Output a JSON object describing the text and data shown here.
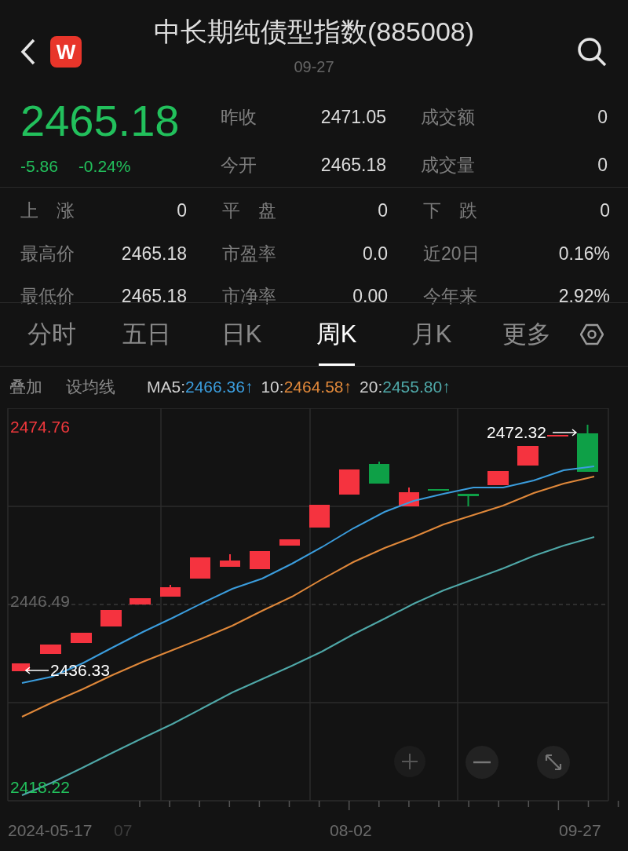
{
  "header": {
    "title": "中长期纯债型指数(885008)",
    "date": "09-27",
    "badge": "W"
  },
  "quote": {
    "price": "2465.18",
    "change": "-5.86",
    "change_pct": "-0.24%",
    "color": "#22c05c"
  },
  "quote_stats": [
    {
      "label": "昨收",
      "value": "2471.05"
    },
    {
      "label": "成交额",
      "value": "0"
    },
    {
      "label": "今开",
      "value": "2465.18"
    },
    {
      "label": "成交量",
      "value": "0"
    }
  ],
  "stats": [
    {
      "label": "上　涨",
      "value": "0"
    },
    {
      "label": "平　盘",
      "value": "0"
    },
    {
      "label": "下　跌",
      "value": "0"
    },
    {
      "label": "最高价",
      "value": "2465.18"
    },
    {
      "label": "市盈率",
      "value": "0.0"
    },
    {
      "label": "近20日",
      "value": "0.16%"
    },
    {
      "label": "最低价",
      "value": "2465.18"
    },
    {
      "label": "市净率",
      "value": "0.00"
    },
    {
      "label": "今年来",
      "value": "2.92%"
    }
  ],
  "tabs": [
    {
      "label": "分时",
      "selected": false
    },
    {
      "label": "五日",
      "selected": false
    },
    {
      "label": "日K",
      "selected": false
    },
    {
      "label": "周K",
      "selected": true
    },
    {
      "label": "月K",
      "selected": false
    },
    {
      "label": "更多",
      "selected": false
    }
  ],
  "ma_bar": {
    "overlay": "叠加",
    "set_ma": "设均线",
    "indicators": [
      {
        "name": "MA5:",
        "value": "2466.36↑",
        "color": "#3b9ddd"
      },
      {
        "name": "10:",
        "value": "2464.58↑",
        "color": "#e0883a"
      },
      {
        "name": "20:",
        "value": "2455.80↑",
        "color": "#4fa8a8"
      }
    ]
  },
  "chart": {
    "high_label": "2474.76",
    "mid_label": "2446.49",
    "low_label": "2418.22",
    "last_label": "2472.32",
    "first_label": "2436.33",
    "x_labels": [
      "2024-05-17",
      "07",
      "08-02",
      "09-27"
    ]
  }
}
